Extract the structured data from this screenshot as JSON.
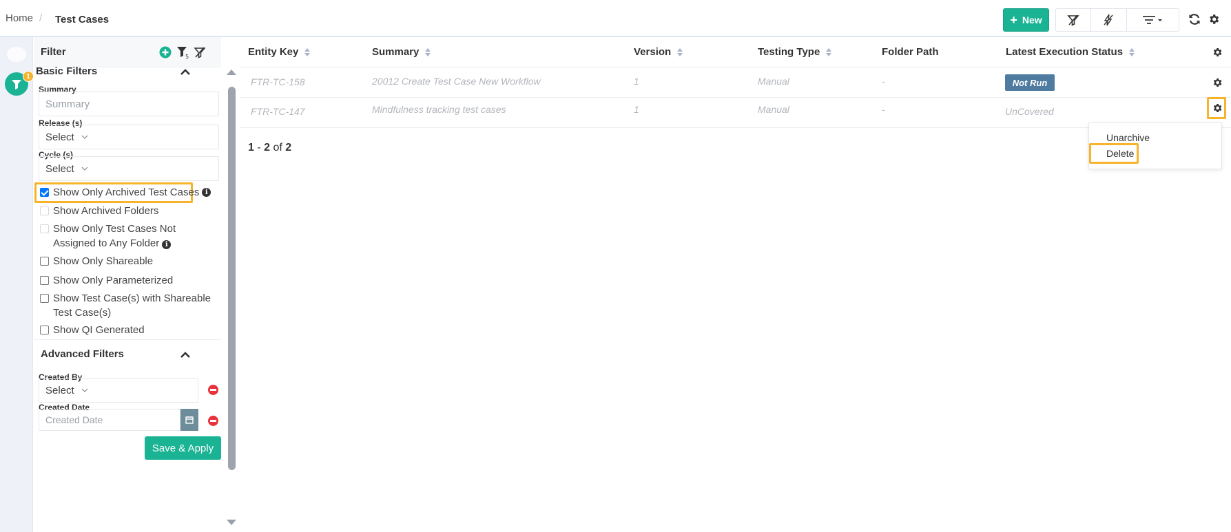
{
  "breadcrumb": {
    "home": "Home",
    "separator": "/",
    "current": "Test Cases"
  },
  "toolbar": {
    "new_label": "New",
    "new_icon": "plus-icon"
  },
  "rail": {
    "filter_badge": "1"
  },
  "filter": {
    "title": "Filter",
    "basic_title": "Basic Filters",
    "summary": {
      "label": "Summary",
      "placeholder": "Summary"
    },
    "release": {
      "label": "Release (s)",
      "value": "Select"
    },
    "cycle": {
      "label": "Cycle (s)",
      "value": "Select"
    },
    "checkboxes": [
      {
        "label": "Show Only Archived Test Cases",
        "checked": true
      },
      {
        "label": "Show Archived Folders",
        "checked": false
      },
      {
        "label_line1": "Show Only Test Cases Not",
        "label_line2": "Assigned to Any Folder",
        "checked": false
      },
      {
        "label": "Show Only Shareable",
        "checked": false
      },
      {
        "label": "Show Only Parameterized",
        "checked": false
      },
      {
        "label_line1": "Show Test Case(s) with Shareable",
        "label_line2": "Test Case(s)",
        "checked": false
      },
      {
        "label": "Show QI Generated",
        "checked": false
      }
    ],
    "advanced_title": "Advanced Filters",
    "created_by": {
      "label": "Created By",
      "value": "Select"
    },
    "created_date": {
      "label": "Created Date",
      "placeholder": "Created Date"
    },
    "save_label": "Save & Apply"
  },
  "grid": {
    "columns": [
      "Entity Key",
      "Summary",
      "Version",
      "Testing Type",
      "Folder Path",
      "Latest Execution Status"
    ],
    "rows": [
      {
        "key": "FTR-TC-158",
        "summary": "20012 Create Test Case New Workflow",
        "version": "1",
        "type": "Manual",
        "folder": "-",
        "status": "Not Run"
      },
      {
        "key": "FTR-TC-147",
        "summary": "Mindfulness tracking test cases",
        "version": "1",
        "type": "Manual",
        "folder": "-",
        "status": "UnCovered"
      }
    ],
    "pager": {
      "from": "1",
      "dash": "-",
      "to": "2",
      "of": "of",
      "total": "2"
    }
  },
  "row_menu": {
    "items": [
      "Unarchive",
      "Delete"
    ]
  },
  "colors": {
    "accent": "#1ab394",
    "highlight": "#f7b32b",
    "status_badge": "#4f7ba0",
    "danger": "#e8323c"
  }
}
